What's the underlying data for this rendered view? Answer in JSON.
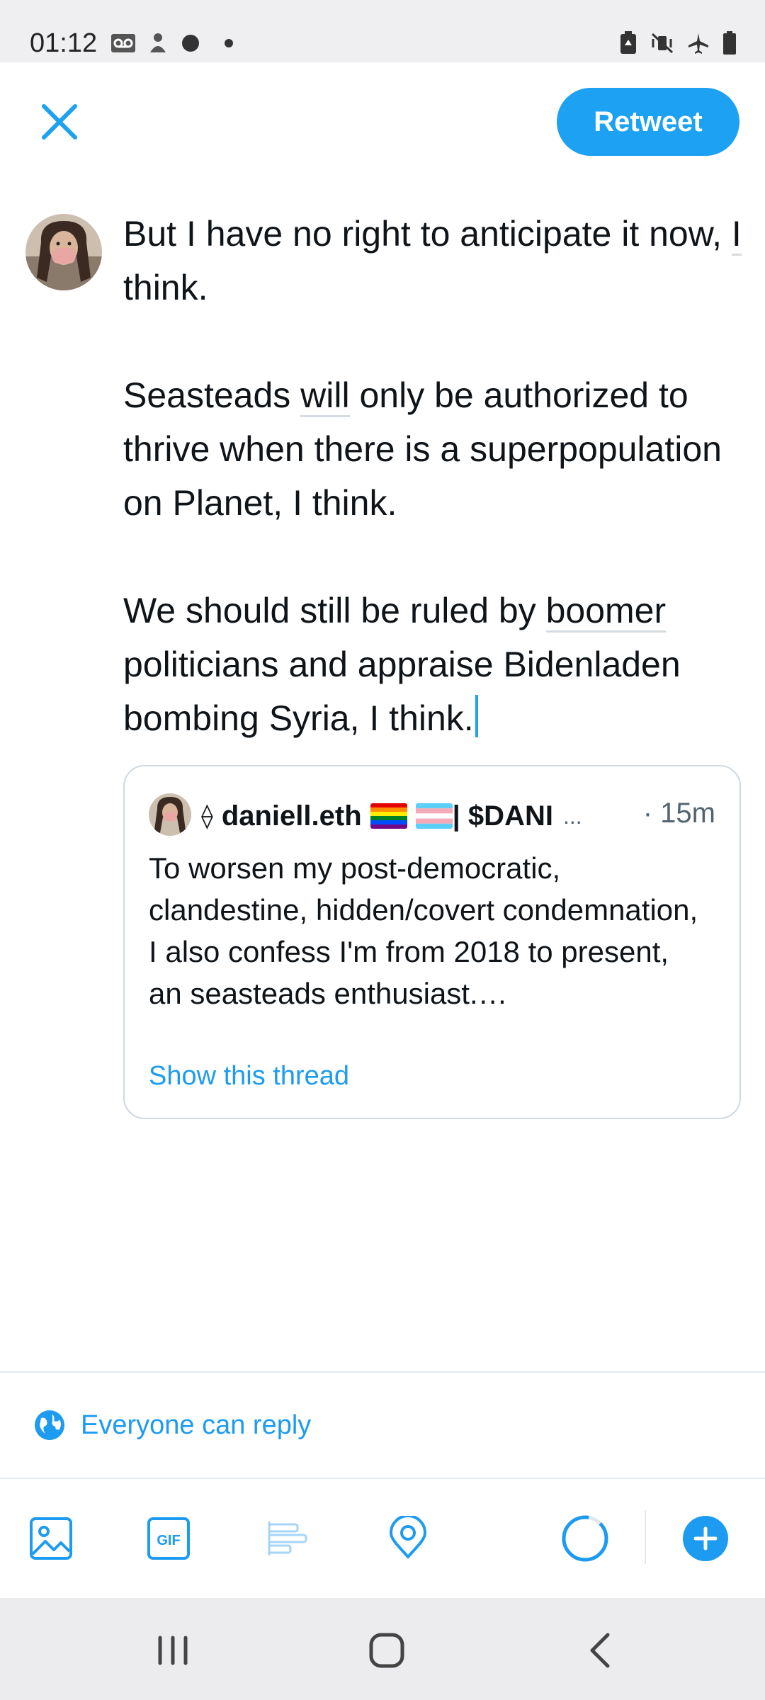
{
  "status_bar": {
    "time": "01:12"
  },
  "header": {
    "retweet_label": "Retweet"
  },
  "composer": {
    "p1a": "But I have no right to anticipate it now, ",
    "p1u": "I",
    "p1b": " think.",
    "p2a": "Seasteads ",
    "p2u": "will",
    "p2b": " only be authorized to thrive when there is a superpopulation on Planet, I think.",
    "p3a": "We should still be ruled by ",
    "p3u": "boomer",
    "p3b": " politicians and appraise Bidenladen bombing Syria, I think."
  },
  "quote": {
    "eth_symbol": "⟠",
    "name": "daniell.eth",
    "handle_rest": " | $DANI",
    "ellipsis": "...",
    "time": "· 15m",
    "body": "To worsen my post-democratic, clandestine, hidden/covert condemnation, I also confess I'm from 2018 to present, an seasteads enthusiast.…",
    "show_thread": "Show this thread"
  },
  "reply_setting": {
    "label": "Everyone can reply"
  },
  "toolbar": {
    "icons": [
      "image-icon",
      "gif-icon",
      "poll-icon",
      "location-icon",
      "character-count-ring",
      "add-tweet-icon"
    ],
    "gif_text": "GIF"
  },
  "colors": {
    "accent": "#1da1f2",
    "link": "#1d9bf0",
    "muted": "#536471",
    "border": "#cfd9de"
  }
}
